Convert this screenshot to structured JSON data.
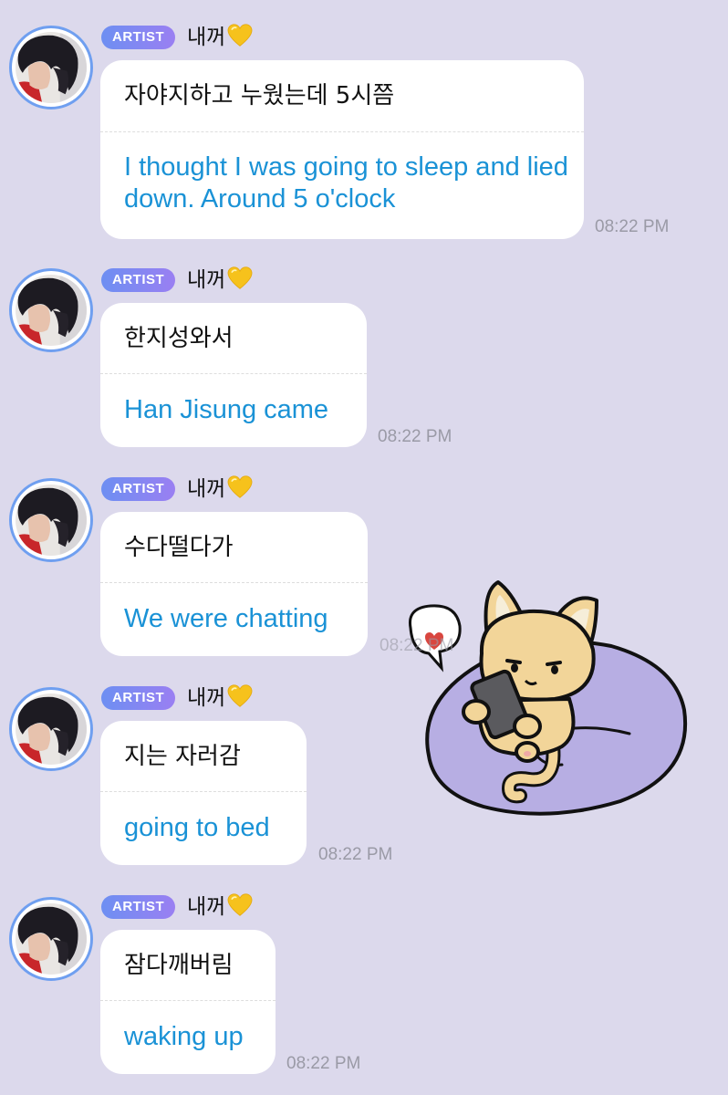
{
  "sender": {
    "badge": "ARTIST",
    "name": "내꺼",
    "name_emoji_icon": "yellow-heart-icon"
  },
  "colors": {
    "background": "#dcd9ec",
    "badge_start": "#6d8ff2",
    "badge_end": "#9a7ff2",
    "translation_text": "#1a92d6",
    "timestamp": "#9a9aa6",
    "avatar_ring": "#6f9ff0"
  },
  "messages": [
    {
      "korean": "자야지하고 누웠는데 5시쯤",
      "english": "I thought I was going to sleep and lied down. Around 5 o'clock",
      "time": "08:22 PM"
    },
    {
      "korean": "한지성와서",
      "english": "Han Jisung came",
      "time": "08:22 PM"
    },
    {
      "korean": "수다떨다가",
      "english": "We were chatting",
      "time": "08:22 PM"
    },
    {
      "korean": "지는 자러감",
      "english": "going to bed",
      "time": "08:22 PM"
    },
    {
      "korean": "잠다깨버림",
      "english": "waking up",
      "time": "08:22 PM"
    }
  ],
  "sticker": {
    "icon": "cat-on-beanbag-with-phone-sticker"
  }
}
